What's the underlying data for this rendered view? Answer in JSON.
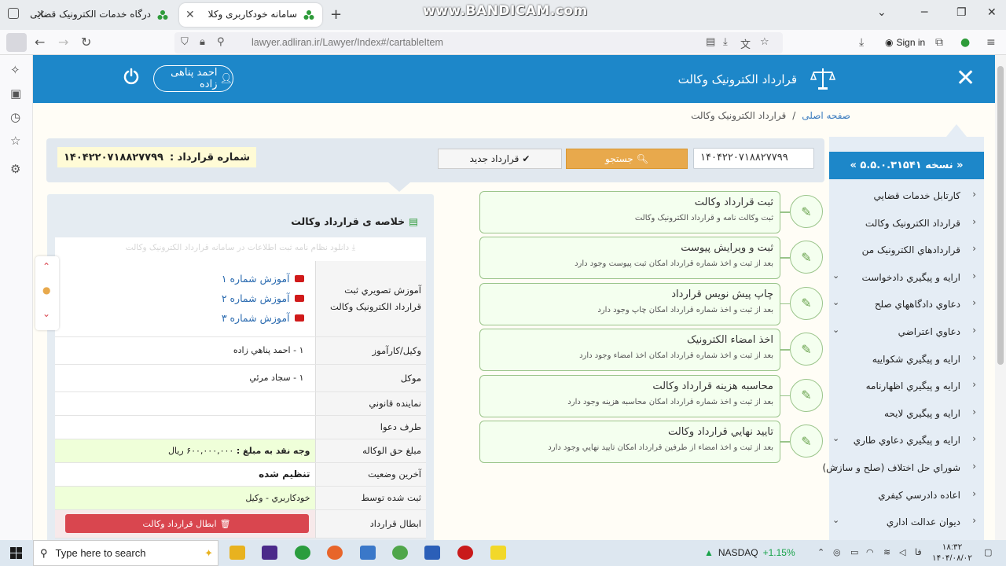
{
  "browser": {
    "tabs": [
      {
        "title": "درگاه خدمات الکترونیک قضایی",
        "active": false
      },
      {
        "title": "سامانه خودکاربری وکلا",
        "active": true
      }
    ],
    "watermark": "www.BANDICAM.com",
    "url": "lawyer.adliran.ir/Lawyer/Index#/cartableItem",
    "signin_label": "Sign in"
  },
  "header": {
    "title": "قرارداد الکترونيک وکالت",
    "user_name": "احمد پناهی زاده",
    "brand_color": "#1d87c9"
  },
  "breadcrumb": {
    "home": "صفحه اصلی",
    "current": "قرارداد الکترونيک وکالت"
  },
  "sidebar": {
    "version": "« نسخه ۵.۵.۰.۳۱۵۴۱ »",
    "items": [
      {
        "label": "کارتابل خدمات قضايي",
        "expandable": false
      },
      {
        "label": "قرارداد الکترونيک وکالت",
        "expandable": false
      },
      {
        "label": "قراردادهاي الکترونيک من",
        "expandable": false
      },
      {
        "label": "ارايه و پيگيري دادخواست",
        "expandable": true
      },
      {
        "label": "دعاوي دادگاههاي صلح",
        "expandable": true
      },
      {
        "label": "دعاوي اعتراضي",
        "expandable": true
      },
      {
        "label": "ارايه و پيگيري شکواييه",
        "expandable": false
      },
      {
        "label": "ارايه و پيگيري اظهارنامه",
        "expandable": false
      },
      {
        "label": "ارايه و پيگيري لايحه",
        "expandable": false
      },
      {
        "label": "ارايه و پيگيري دعاوي طاري",
        "expandable": true
      },
      {
        "label": "شوراي حل اختلاف (صلح و سازش)",
        "expandable": true
      },
      {
        "label": "اعاده دادرسي کيفري",
        "expandable": false
      },
      {
        "label": "ديوان عدالت اداري",
        "expandable": true
      }
    ]
  },
  "search": {
    "contract_no_label": "شماره قرارداد :",
    "contract_no_value": "۱۴۰۴۲۲۰۷۱۸۸۲۷۷۹۹",
    "input_value": "۱۴۰۴۲۲۰۷۱۸۸۲۷۷۹۹",
    "search_label": "جستجو",
    "new_label": "قرارداد جدید"
  },
  "steps": [
    {
      "title": "ثبت قرارداد وکالت",
      "desc": "ثبت وکالت نامه و قرارداد الکترونيک وکالت"
    },
    {
      "title": "ثبت و ويرايش پيوست",
      "desc": "بعد از ثبت و اخذ شماره قرارداد امکان ثبت پيوست وجود دارد"
    },
    {
      "title": "چاپ پيش نويس قرارداد",
      "desc": "بعد از ثبت و اخذ شماره قرارداد امکان چاپ وجود دارد"
    },
    {
      "title": "اخذ امضاء الکترونيک",
      "desc": "بعد از ثبت و اخذ شماره قرارداد امکان اخذ امضاء وجود دارد"
    },
    {
      "title": "محاسبه هزينه قرارداد وکالت",
      "desc": "بعد از ثبت و اخذ شماره قرارداد امکان محاسبه هزينه وجود دارد"
    },
    {
      "title": "تاييد نهايي قرارداد وکالت",
      "desc": "بعد از ثبت و اخذ امضاء از طرفين قرارداد امکان تاييد نهايي وجود دارد"
    }
  ],
  "summary": {
    "title": "خلاصه ی قرارداد وکالت",
    "download_text": "دانلود نظام نامه ثبت اطلاعات در سامانه قرارداد الکترونيک وکالت",
    "training_label": "آموزش تصويري ثبت قرارداد الکترونيک وکالت",
    "videos": [
      "آموزش شماره ۱",
      "آموزش شماره ۲",
      "آموزش شماره ۳"
    ],
    "rows": [
      {
        "key": "وکيل/کارآموز",
        "value": "۱ - احمد پناهي زاده"
      },
      {
        "key": "موکل",
        "value": "۱ - سجاد مرئي"
      },
      {
        "key": "نماينده قانوني",
        "value": ""
      },
      {
        "key": "طرف دعوا",
        "value": ""
      },
      {
        "key": "مبلغ حق الوکاله",
        "value_bold": "وجه نقد به مبلغ :",
        "value": "۶۰۰,۰۰۰,۰۰۰ ريال"
      },
      {
        "key": "آخرين وضعيت",
        "value": "تنظيم شده"
      },
      {
        "key": "ثبت شده توسط",
        "value": "خودکاربري - وکيل"
      },
      {
        "key": "ابطال قرارداد",
        "value": ""
      }
    ],
    "cancel_label": "ابطال قرارداد وکالت"
  },
  "taskbar": {
    "search_placeholder": "Type here to search",
    "ticker": "NASDAQ",
    "ticker_change": "+1.15%",
    "lang": "فا",
    "time": "۱۸:۳۲",
    "date": "۱۴۰۴/۰۸/۰۲"
  }
}
